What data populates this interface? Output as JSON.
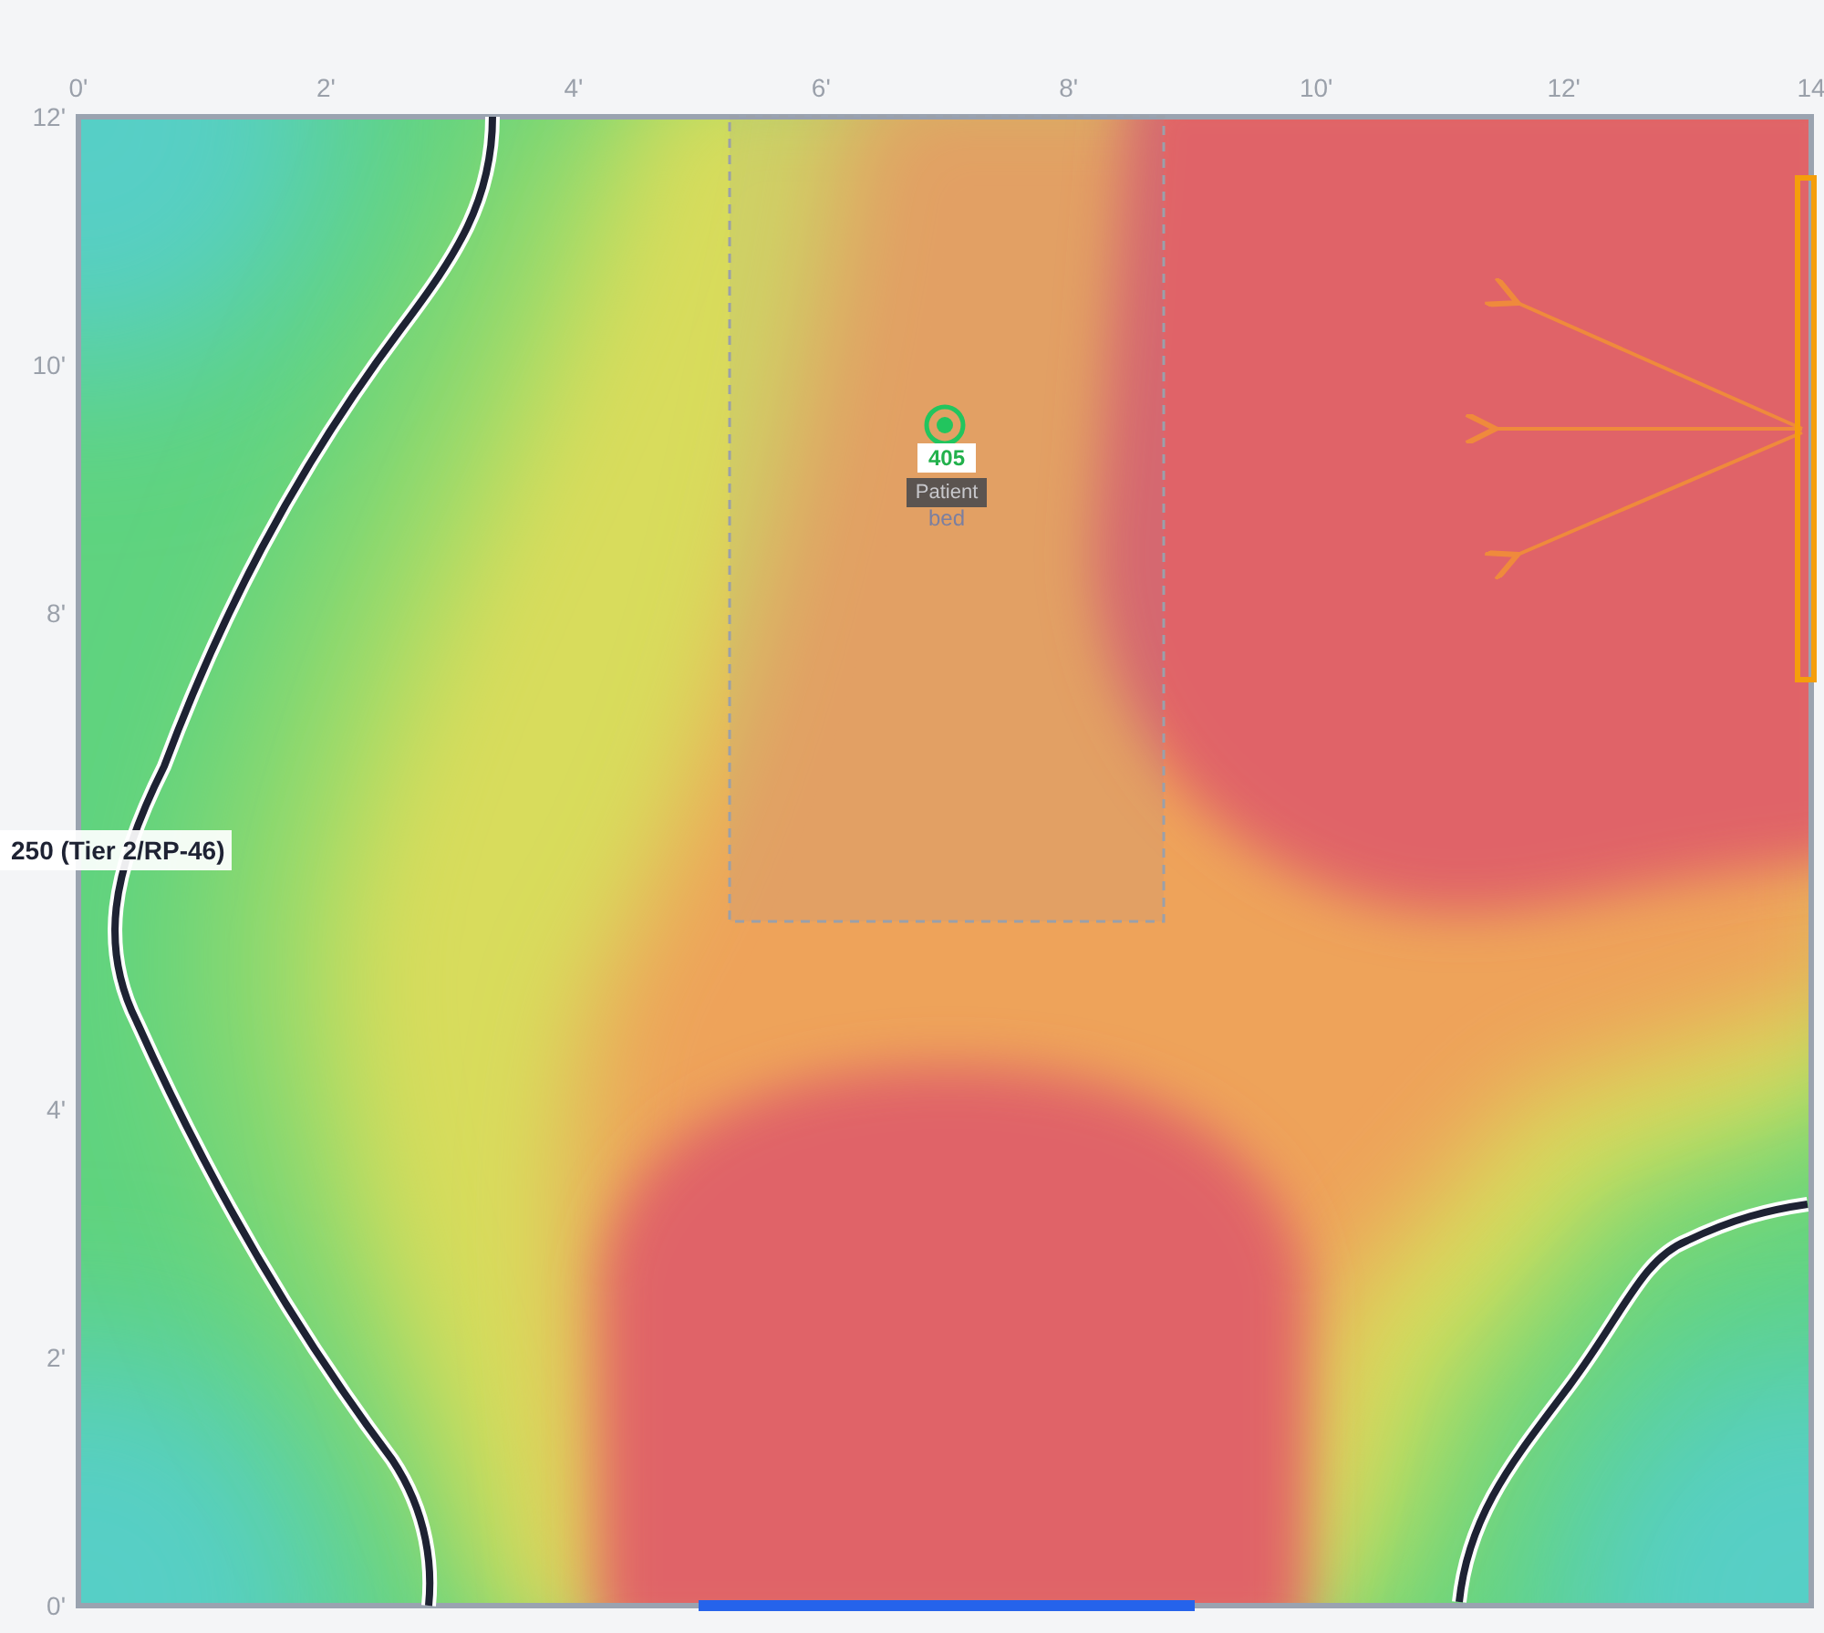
{
  "x_axis": {
    "ticks": [
      "0'",
      "2'",
      "4'",
      "6'",
      "8'",
      "10'",
      "12'",
      "14"
    ]
  },
  "y_axis": {
    "ticks": [
      "12'",
      "10'",
      "8'",
      "4'",
      "2'",
      "0'"
    ]
  },
  "contour_label": "250 (Tier 2/RP-46)",
  "marker": {
    "reading": "405",
    "label_lines": [
      "Patient",
      "bed"
    ]
  }
}
